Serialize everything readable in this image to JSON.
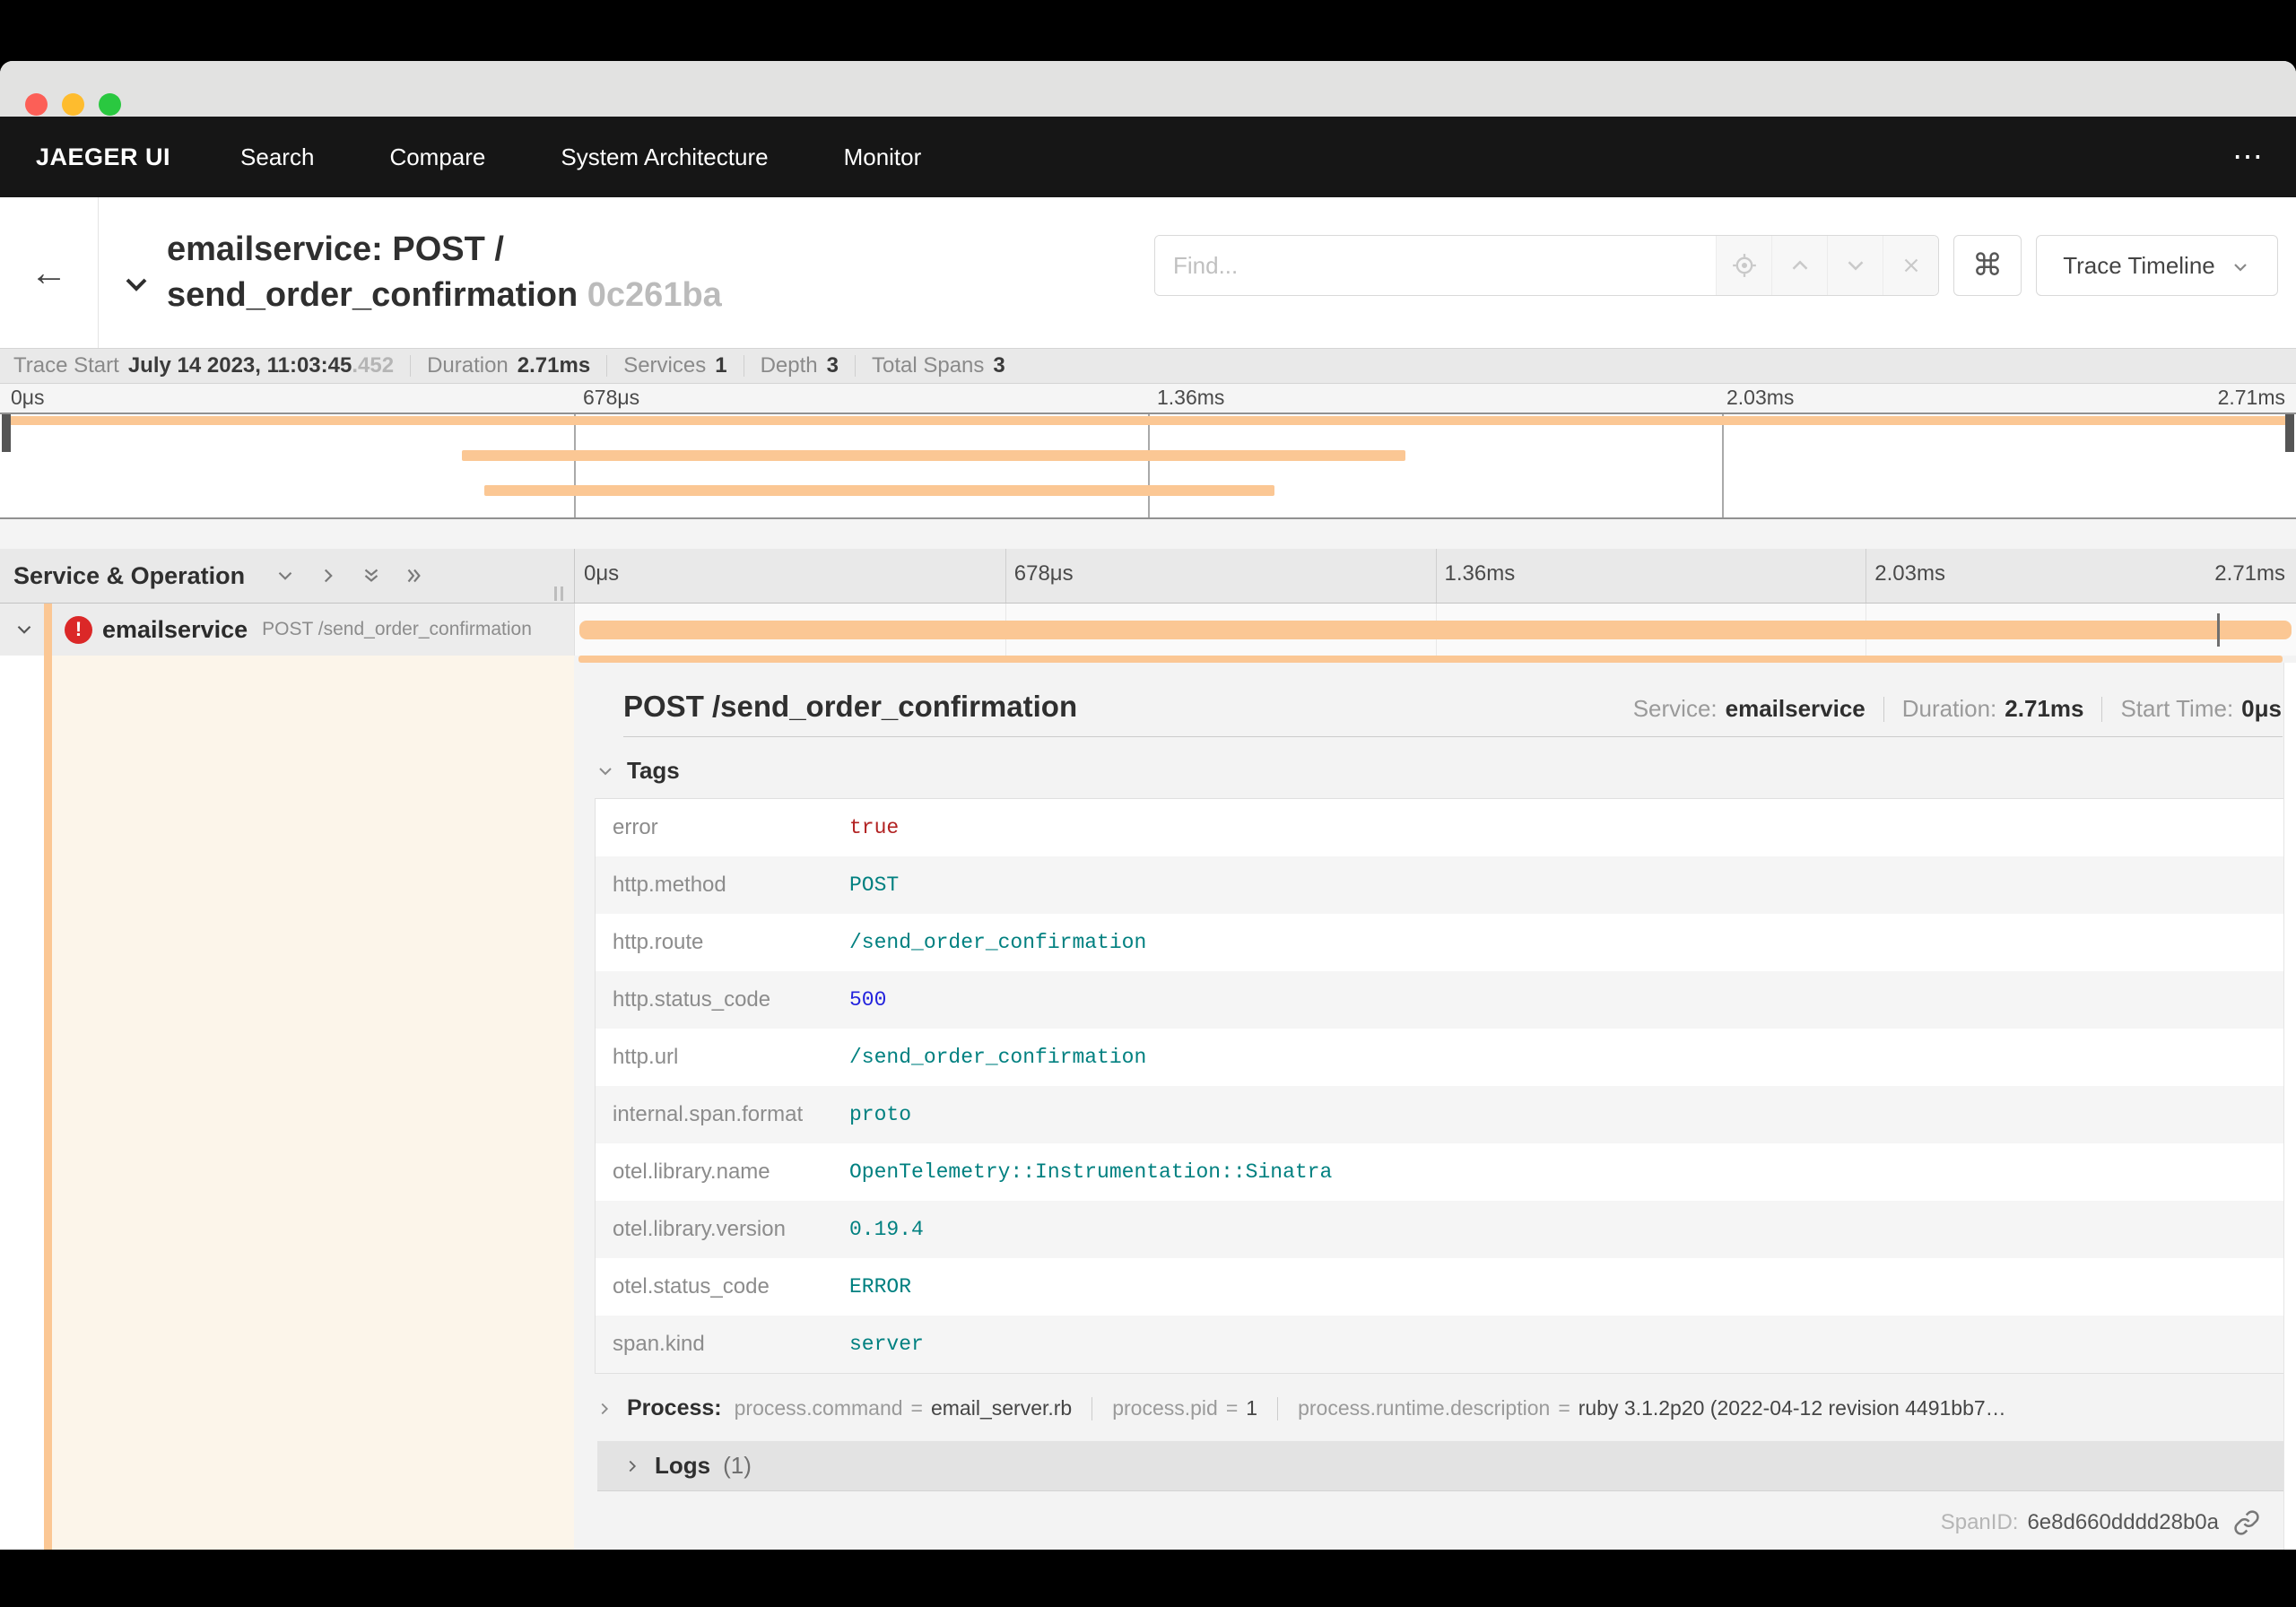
{
  "window": {
    "traffic": {
      "red": "#fc5f57",
      "yellow": "#febc2e",
      "green": "#2ac840"
    }
  },
  "nav": {
    "brand": "JAEGER UI",
    "items": [
      "Search",
      "Compare",
      "System Architecture",
      "Monitor"
    ],
    "overflow": "⋯"
  },
  "trace_header": {
    "back": "←",
    "title_line1": "emailservice: POST /",
    "title_line2": "send_order_confirmation",
    "trace_id_short": "0c261ba",
    "find_placeholder": "Find...",
    "shortcut_key": "⌘",
    "view_selector": "Trace Timeline"
  },
  "summary": {
    "items": [
      {
        "label": "Trace Start",
        "value": "July 14 2023, 11:03:45",
        "suffix": ".452"
      },
      {
        "label": "Duration",
        "value": "2.71ms",
        "suffix": ""
      },
      {
        "label": "Services",
        "value": "1",
        "suffix": ""
      },
      {
        "label": "Depth",
        "value": "3",
        "suffix": ""
      },
      {
        "label": "Total Spans",
        "value": "3",
        "suffix": ""
      }
    ]
  },
  "timeline": {
    "ticks": [
      "0μs",
      "678μs",
      "1.36ms",
      "2.03ms",
      "2.71ms"
    ],
    "accent_orange": "#fbc794",
    "minimap_spans": [
      {
        "left": "0.3%",
        "width": "99.4%"
      },
      {
        "left": "20.1%",
        "width": "41.1%"
      },
      {
        "left": "21.1%",
        "width": "34.4%"
      }
    ]
  },
  "span_list": {
    "header_title": "Service & Operation",
    "row": {
      "service": "emailservice",
      "operation": "POST /send_order_confirmation",
      "error_glyph": "!",
      "error_color": "#db2828",
      "bar": {
        "left": "0.26%",
        "width": "99.5%"
      },
      "error_tick_left": "95.4%"
    }
  },
  "detail": {
    "title": "POST /send_order_confirmation",
    "meta": [
      {
        "label": "Service:",
        "value": "emailservice"
      },
      {
        "label": "Duration:",
        "value": "2.71ms"
      },
      {
        "label": "Start Time:",
        "value": "0μs"
      }
    ],
    "tags": {
      "header": "Tags",
      "rows": [
        {
          "key": "error",
          "value": "true",
          "cls": "tv bool"
        },
        {
          "key": "http.method",
          "value": "POST",
          "cls": "tv str"
        },
        {
          "key": "http.route",
          "value": "/send_order_confirmation",
          "cls": "tv str"
        },
        {
          "key": "http.status_code",
          "value": "500",
          "cls": "tv num"
        },
        {
          "key": "http.url",
          "value": "/send_order_confirmation",
          "cls": "tv str"
        },
        {
          "key": "internal.span.format",
          "value": "proto",
          "cls": "tv str"
        },
        {
          "key": "otel.library.name",
          "value": "OpenTelemetry::Instrumentation::Sinatra",
          "cls": "tv str"
        },
        {
          "key": "otel.library.version",
          "value": "0.19.4",
          "cls": "tv str"
        },
        {
          "key": "otel.status_code",
          "value": "ERROR",
          "cls": "tv str"
        },
        {
          "key": "span.kind",
          "value": "server",
          "cls": "tv str"
        }
      ]
    },
    "process": {
      "header": "Process:",
      "items": [
        {
          "key": "process.command",
          "value": "email_server.rb"
        },
        {
          "key": "process.pid",
          "value": "1"
        },
        {
          "key": "process.runtime.description",
          "value": "ruby 3.1.2p20 (2022-04-12 revision 4491bb7…"
        }
      ]
    },
    "logs": {
      "header": "Logs",
      "count": "(1)"
    },
    "span_id": {
      "label": "SpanID:",
      "value": "6e8d660dddd28b0a"
    }
  }
}
